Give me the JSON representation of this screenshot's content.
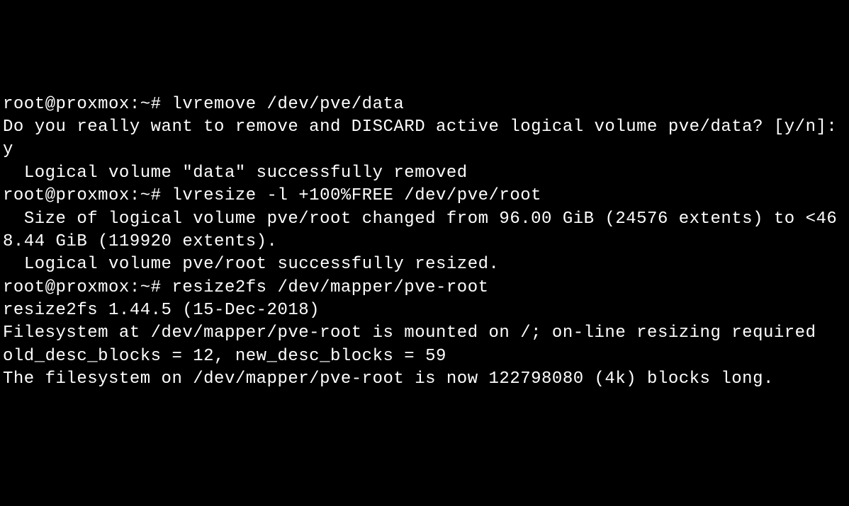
{
  "terminal": {
    "lines": [
      "root@proxmox:~# lvremove /dev/pve/data",
      "Do you really want to remove and DISCARD active logical volume pve/data? [y/n]: y",
      "  Logical volume \"data\" successfully removed",
      "root@proxmox:~# lvresize -l +100%FREE /dev/pve/root",
      "  Size of logical volume pve/root changed from 96.00 GiB (24576 extents) to <468.44 GiB (119920 extents).",
      "  Logical volume pve/root successfully resized.",
      "root@proxmox:~# resize2fs /dev/mapper/pve-root",
      "resize2fs 1.44.5 (15-Dec-2018)",
      "Filesystem at /dev/mapper/pve-root is mounted on /; on-line resizing required",
      "old_desc_blocks = 12, new_desc_blocks = 59",
      "The filesystem on /dev/mapper/pve-root is now 122798080 (4k) blocks long."
    ]
  }
}
